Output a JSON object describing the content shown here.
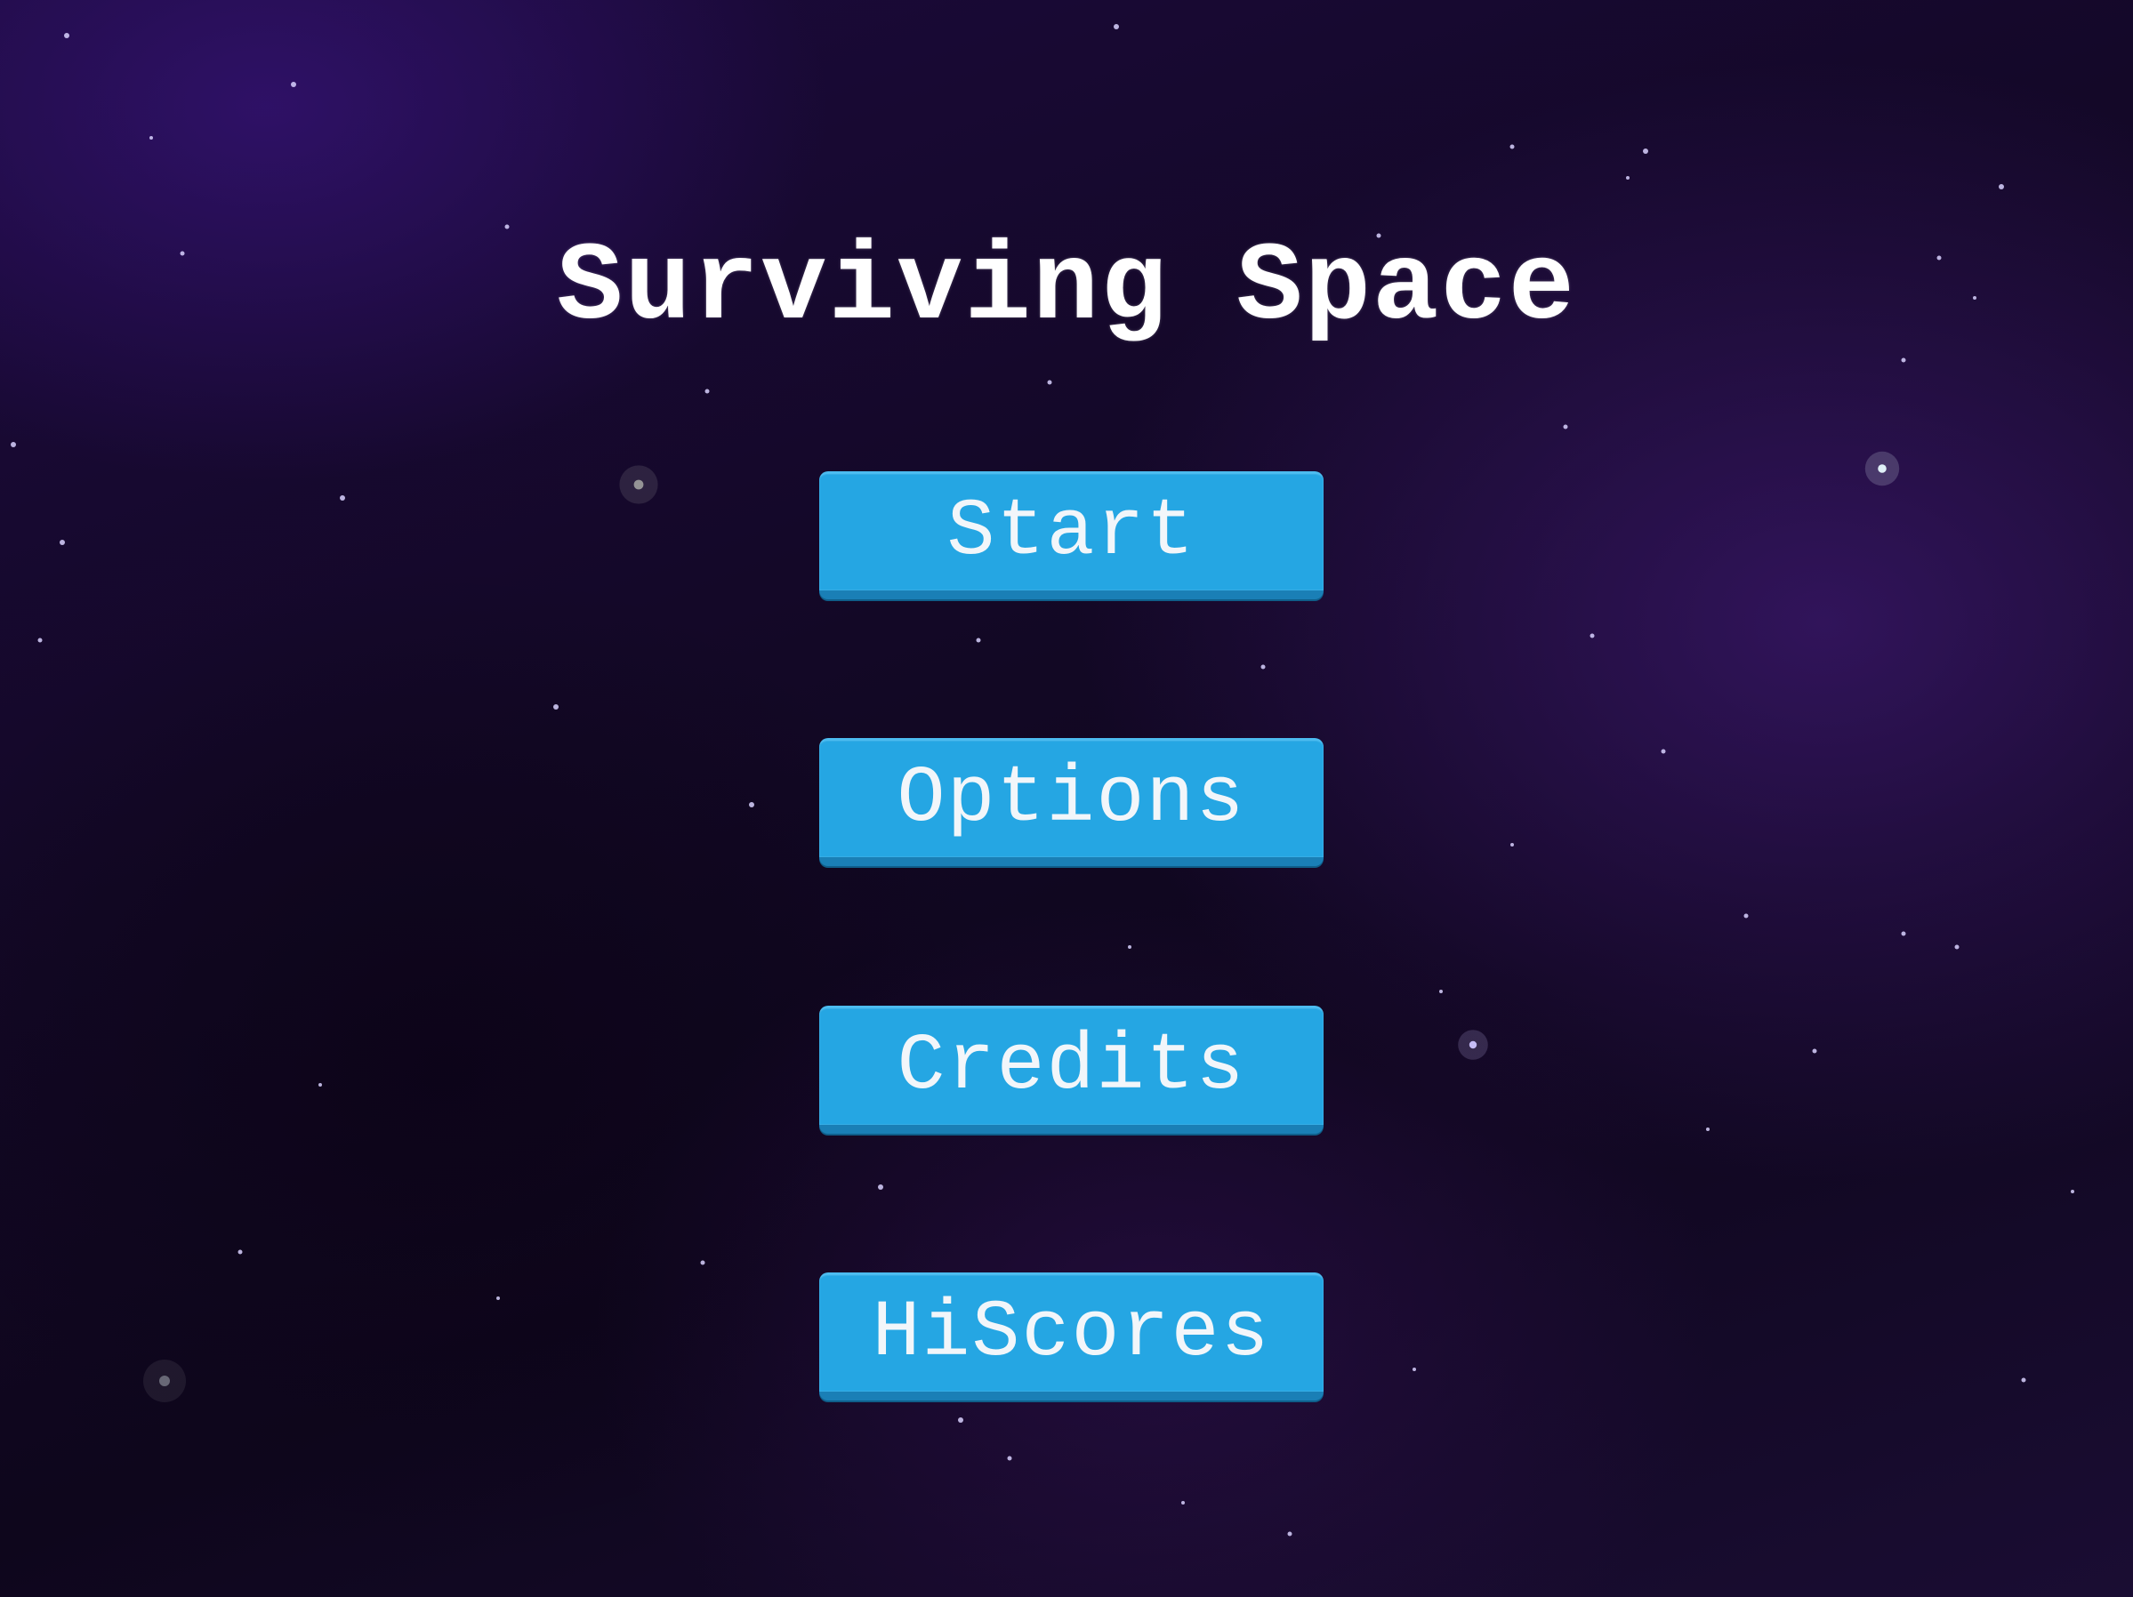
{
  "game": {
    "title": "Surviving Space"
  },
  "menu": {
    "start_label": "Start",
    "options_label": "Options",
    "credits_label": "Credits",
    "hiscores_label": "HiScores"
  },
  "colors": {
    "background_dark": "#0e061c",
    "background_purple": "#1c0a3d",
    "button_fill": "#25a6e3",
    "button_shadow": "#1a7fb6",
    "button_text": "#f2f6fa",
    "title_text": "#ffffff"
  }
}
